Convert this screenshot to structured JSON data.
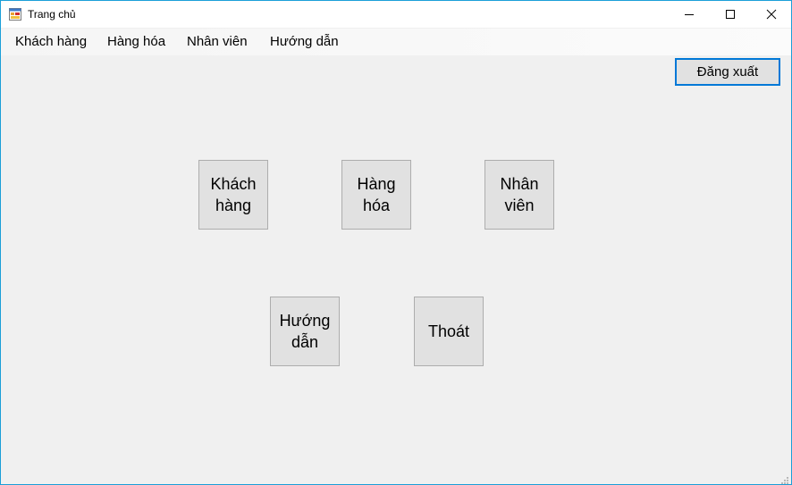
{
  "window": {
    "title": "Trang chủ",
    "icon": "app-form-icon",
    "controls": [
      "minimize-icon",
      "maximize-icon",
      "close-icon"
    ]
  },
  "menubar": {
    "items": [
      {
        "label": "Khách hàng"
      },
      {
        "label": "Hàng hóa"
      },
      {
        "label": "Nhân viên"
      },
      {
        "label": "Hướng dẫn"
      }
    ]
  },
  "toolbar": {
    "logout_label": "Đăng xuất"
  },
  "tiles": [
    {
      "label": "Khách\nhàng"
    },
    {
      "label": "Hàng\nhóa"
    },
    {
      "label": "Nhân\nviên"
    },
    {
      "label": "Hướng\ndẫn"
    },
    {
      "label": "Thoát"
    }
  ],
  "colors": {
    "window_border": "#1b9fd8",
    "focus_border": "#0078d7",
    "form_background": "#f0f0f0",
    "button_face": "#e1e1e1"
  }
}
